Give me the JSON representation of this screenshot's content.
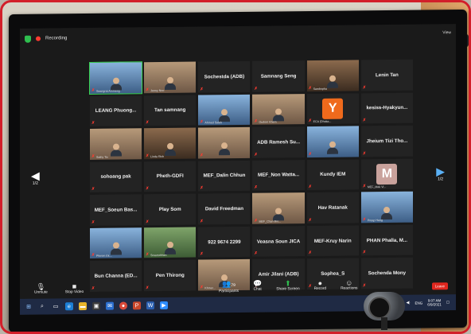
{
  "topbar": {
    "recording_label": "Recording",
    "view_label": "View"
  },
  "navigation": {
    "prev_page": "1/2",
    "next_page": "1/2"
  },
  "participants": [
    {
      "name": "",
      "tag": "Seangrat Ammeng",
      "type": "video",
      "tone": "blue",
      "active": true
    },
    {
      "name": "",
      "tag": "Jenny Noo",
      "type": "video",
      "tone": "warm"
    },
    {
      "name": "Sochestda (ADB)",
      "type": "name"
    },
    {
      "name": "Samnang Seng",
      "type": "name"
    },
    {
      "name": "",
      "tag": "Sambopha",
      "type": "video",
      "tone": "shelf"
    },
    {
      "name": "Lenin Tan",
      "type": "name"
    },
    {
      "name": "LEANG Phuong...",
      "type": "name"
    },
    {
      "name": "Tan samnang",
      "type": "name"
    },
    {
      "name": "",
      "tag": "Ahmed Saleh",
      "type": "video",
      "tone": "blue"
    },
    {
      "name": "",
      "tag": "Oudom Khem",
      "type": "video",
      "tone": "warm"
    },
    {
      "name": "",
      "tag": "ECA (Dhaka...",
      "type": "avatar",
      "letter": "Y",
      "avatar": "y"
    },
    {
      "name": "kesiss-Hyakyun...",
      "type": "name"
    },
    {
      "name": "",
      "tag": "Sothy Tiv",
      "type": "video",
      "tone": "warm"
    },
    {
      "name": "",
      "tag": "Linda Rich",
      "type": "video",
      "tone": "shelf"
    },
    {
      "name": "",
      "type": "video",
      "tone": "warm"
    },
    {
      "name": "ADB Ramesh Su...",
      "type": "name"
    },
    {
      "name": "",
      "type": "video",
      "tone": "blue"
    },
    {
      "name": "Jheium Tizi Tho...",
      "type": "name"
    },
    {
      "name": "sohoang pak",
      "type": "name"
    },
    {
      "name": "Pheth-GDFI",
      "type": "name"
    },
    {
      "name": "MEF_Dalin Chhun",
      "type": "name"
    },
    {
      "name": "MEF_Non Watta...",
      "type": "name"
    },
    {
      "name": "Kundy IEM",
      "type": "name"
    },
    {
      "name": "",
      "tag": "MEF_Mak Vi...",
      "type": "avatar",
      "letter": "M",
      "avatar": "m"
    },
    {
      "name": "MEF_Soeun Bas...",
      "type": "name"
    },
    {
      "name": "Play Som",
      "type": "name"
    },
    {
      "name": "David Freedman",
      "type": "name"
    },
    {
      "name": "",
      "tag": "MEF_Chan Bro...",
      "type": "video",
      "tone": "warm"
    },
    {
      "name": "Hav Ratanak",
      "type": "name"
    },
    {
      "name": "",
      "tag": "Preap Heng",
      "type": "video",
      "tone": "blue"
    },
    {
      "name": "",
      "tag": "Phirom Ek...",
      "type": "video",
      "tone": "blue"
    },
    {
      "name": "",
      "tag": "Sreamchhen",
      "type": "video",
      "tone": "green"
    },
    {
      "name": "922 9674 2299",
      "type": "name"
    },
    {
      "name": "Veasna Soun JICA",
      "type": "name"
    },
    {
      "name": "MEF-Kruy Narin",
      "type": "name"
    },
    {
      "name": "PHAN Phalla, M...",
      "type": "name"
    },
    {
      "name": "Bun Channa (ED...",
      "type": "name"
    },
    {
      "name": "Pen Thirong",
      "type": "name"
    },
    {
      "name": "",
      "tag": "Khmer...",
      "type": "video",
      "tone": "warm"
    },
    {
      "name": "Amir Jilani (ADB)",
      "type": "name"
    },
    {
      "name": "Sophea_S",
      "type": "name"
    },
    {
      "name": "Sochenda Mony",
      "type": "name"
    }
  ],
  "toolbar": {
    "unmute": "Unmute",
    "stop_video": "Stop Video",
    "participants": "Participants",
    "participant_count": "79",
    "chat": "Chat",
    "share_screen": "Share Screen",
    "record": "Record",
    "reactions": "Reactions",
    "leave": "Leave"
  },
  "taskbar": {
    "time": "9:07 AM",
    "date": "6/9/2021",
    "language": "ENG"
  },
  "colors": {
    "frame_border": "#d21f2a",
    "active_speaker": "#39d353",
    "mute_icon": "#ff3b30",
    "share_green": "#2fbf4f",
    "leave_red": "#e0271f",
    "taskbar": "#1f2a44"
  }
}
